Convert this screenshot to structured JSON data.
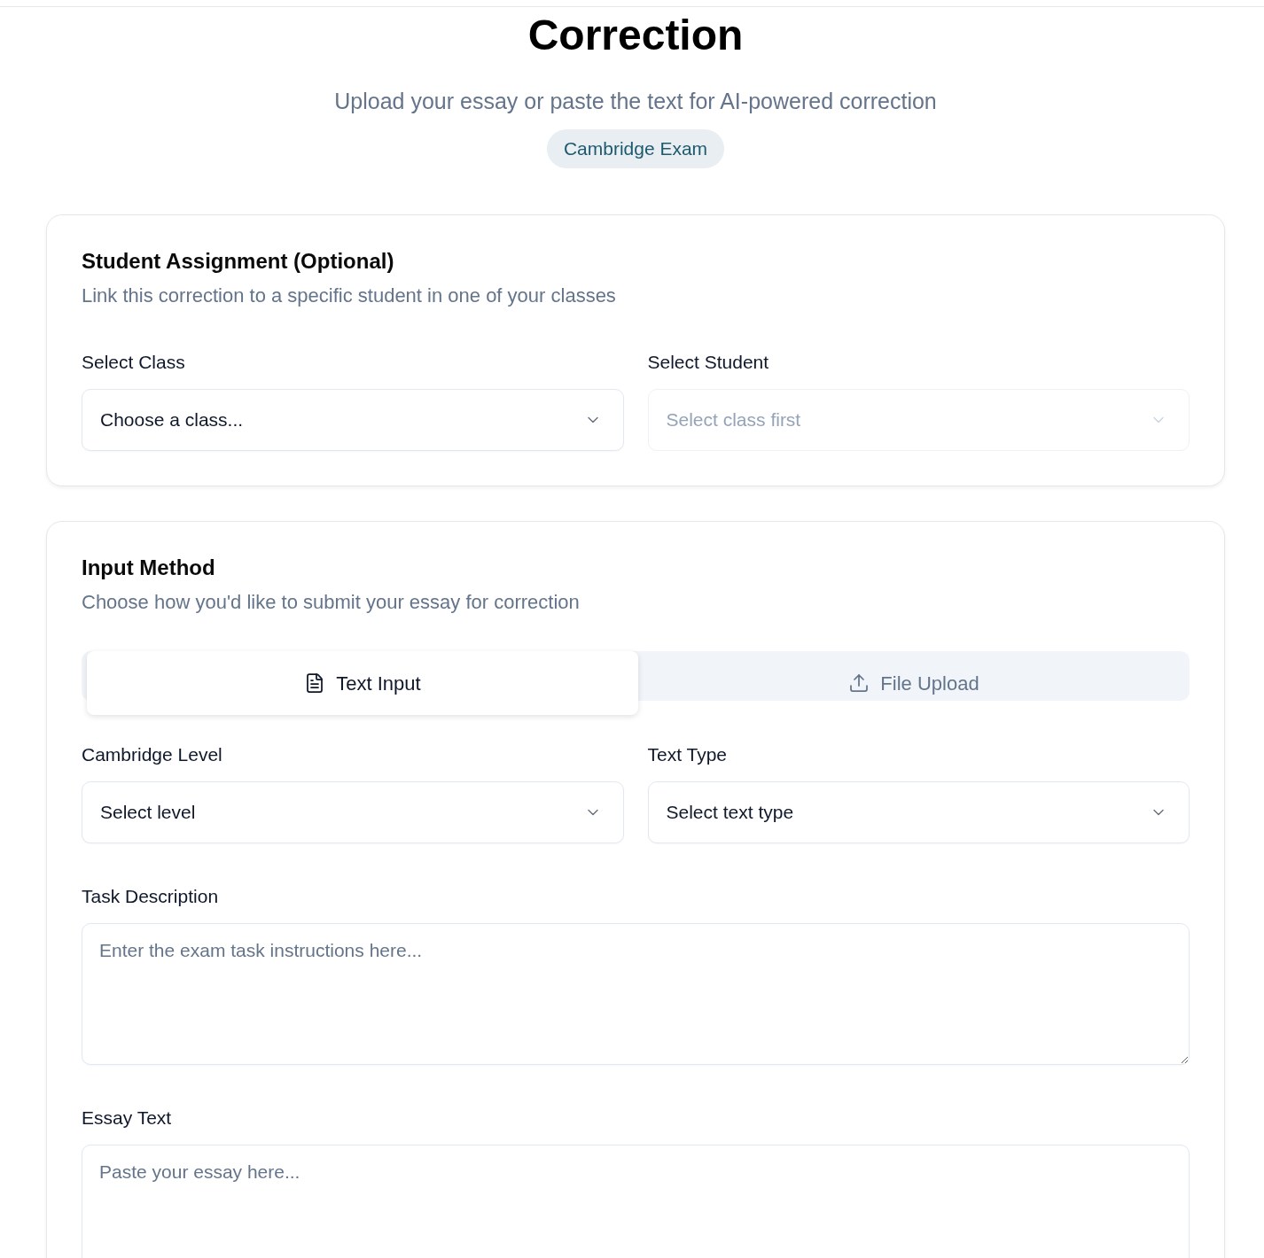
{
  "header": {
    "title": "Correction",
    "subtitle": "Upload your essay or paste the text for AI-powered correction",
    "badge": "Cambridge Exam"
  },
  "student_assignment": {
    "title": "Student Assignment (Optional)",
    "description": "Link this correction to a specific student in one of your classes",
    "selects": [
      {
        "label": "Select Class",
        "value": "Choose a class...",
        "disabled": false
      },
      {
        "label": "Select Student",
        "value": "Select class first",
        "disabled": true
      }
    ]
  },
  "input_method": {
    "title": "Input Method",
    "description": "Choose how you'd like to submit your essay for correction",
    "tabs": [
      {
        "label": "Text Input",
        "kind": "text",
        "selected": true
      },
      {
        "label": "File Upload",
        "kind": "upload",
        "selected": false
      }
    ],
    "selects": [
      {
        "label": "Cambridge Level",
        "value": "Select level",
        "disabled": false
      },
      {
        "label": "Text Type",
        "value": "Select text type",
        "disabled": false
      }
    ],
    "text_areas": [
      {
        "label": "Task Description",
        "placeholder": "Enter the exam task instructions here..."
      },
      {
        "label": "Essay Text",
        "placeholder": "Paste your essay here..."
      }
    ]
  }
}
